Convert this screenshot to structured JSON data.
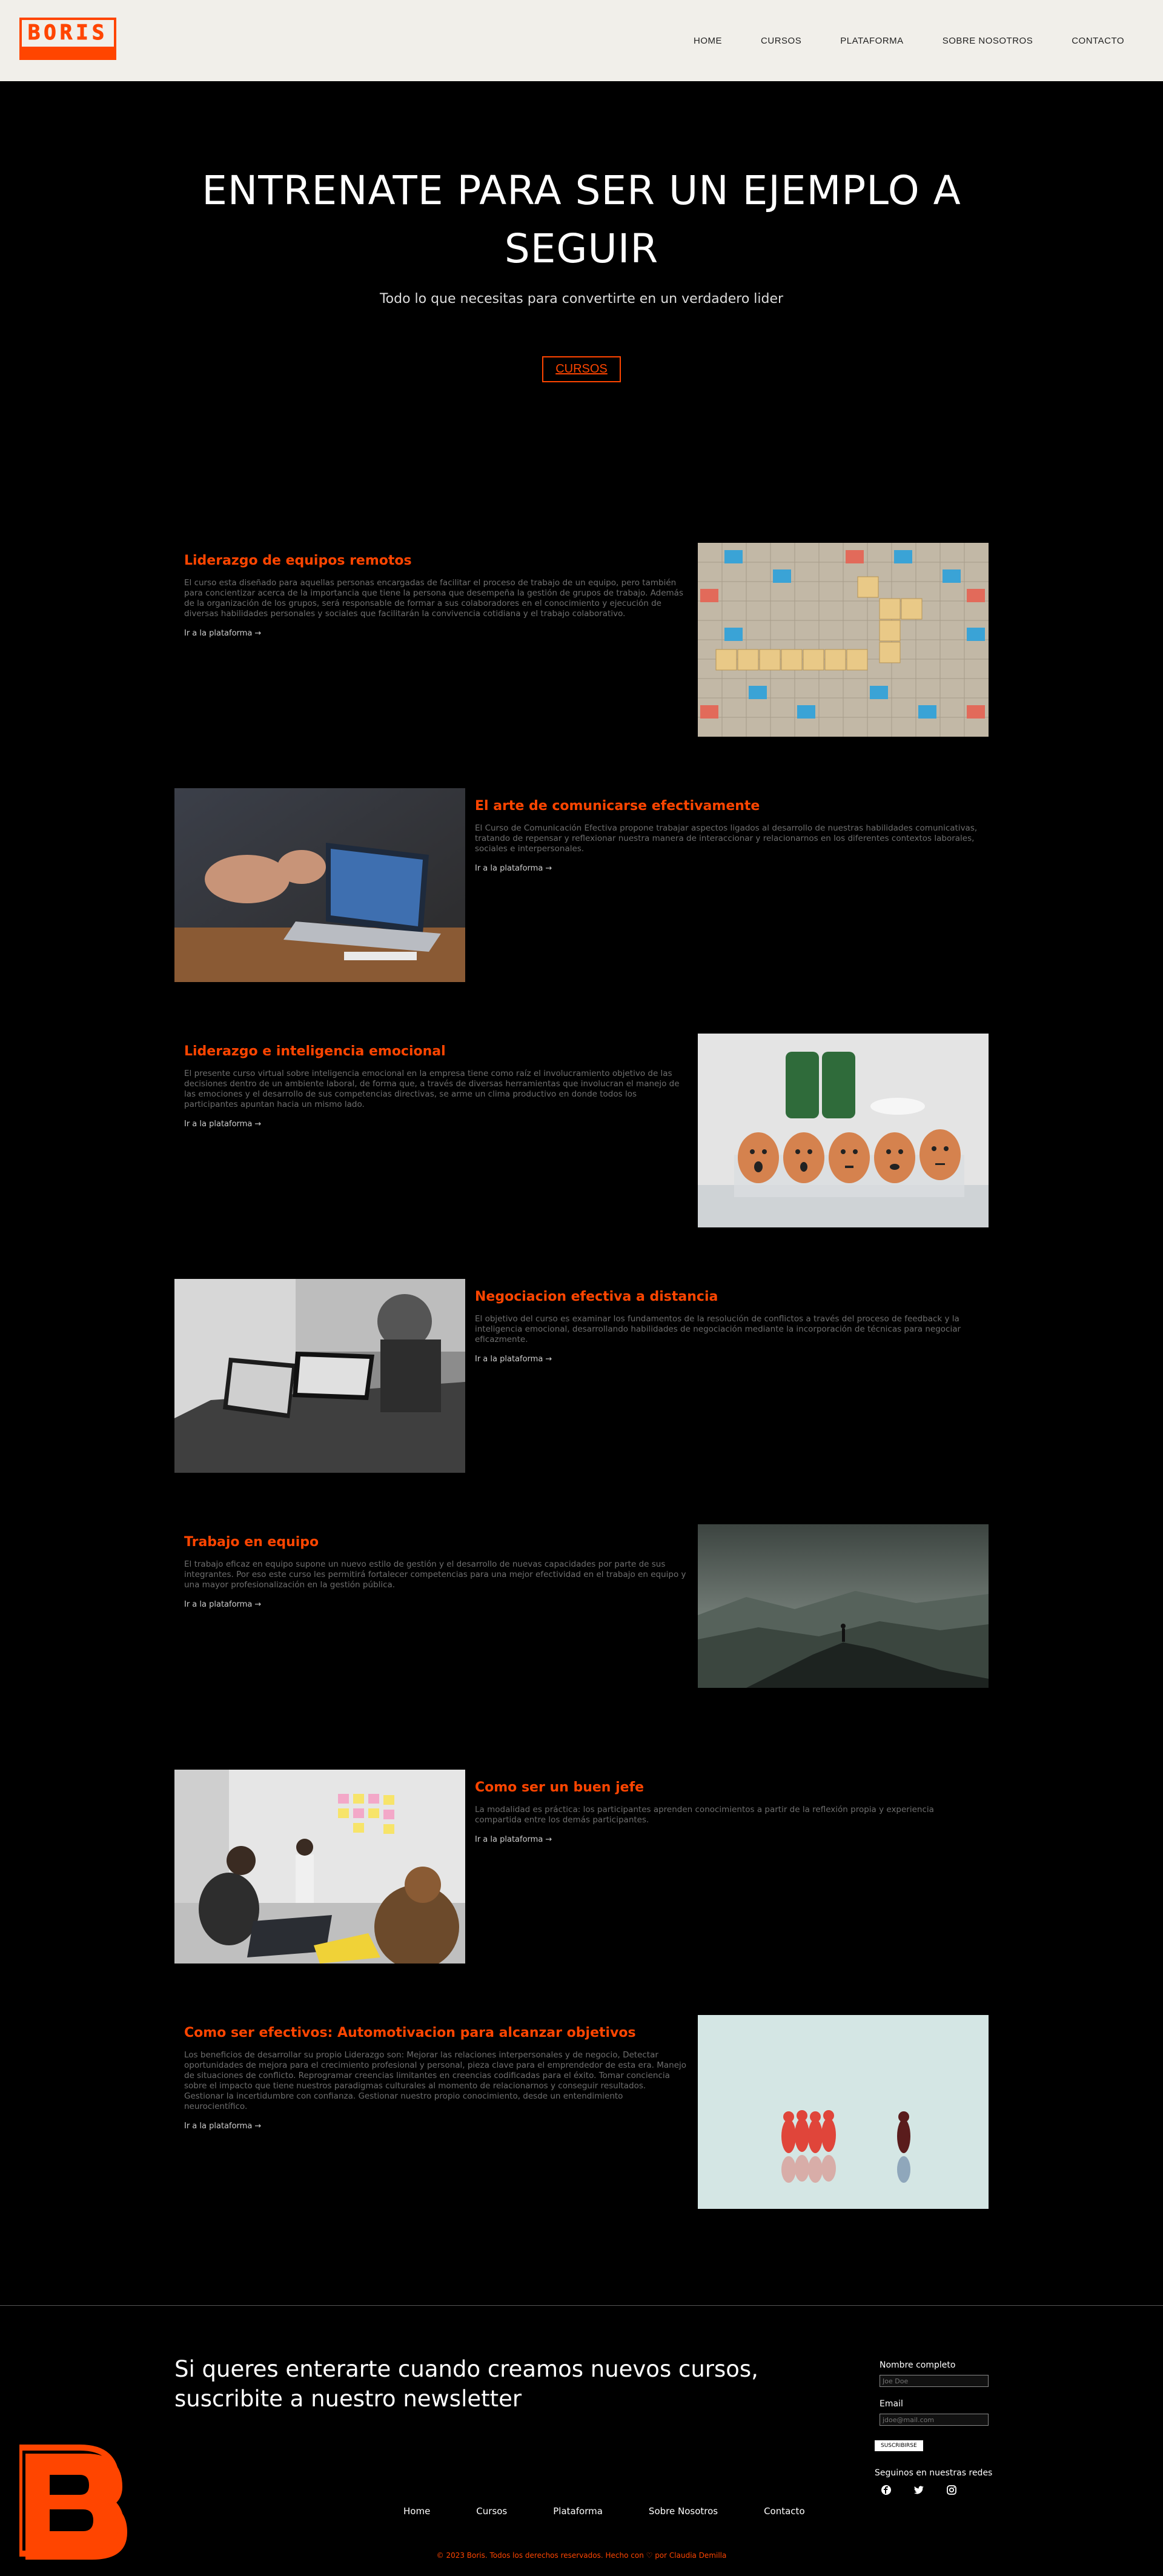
{
  "brand": {
    "logo_text": "BORIS",
    "accent": "#ff4500"
  },
  "nav": {
    "items": [
      {
        "label": "HOME"
      },
      {
        "label": "CURSOS"
      },
      {
        "label": "PLATAFORMA"
      },
      {
        "label": "SOBRE NOSOTROS"
      },
      {
        "label": "CONTACTO"
      }
    ]
  },
  "hero": {
    "title": "ENTRENATE PARA SER UN EJEMPLO A SEGUIR",
    "subtitle": "Todo lo que necesitas para convertirte en un verdadero lider",
    "button": "CURSOS"
  },
  "courses": [
    {
      "title": "Liderazgo de equipos remotos",
      "description": "El curso esta diseñado para aquellas personas encargadas de facilitar el proceso de trabajo de un equipo, pero también para concientizar acerca de la importancia que tiene la persona que desempeña la gestión de grupos de trabajo. Además de la organización de los grupos, será responsable de formar a sus colaboradores en el conocimiento y ejecución de diversas habilidades personales y sociales que facilitarán la convivencia cotidiana y el trabajo colaborativo.",
      "link": "Ir a la plataforma →",
      "image": "scrabble-team-succeed"
    },
    {
      "title": "El arte de comunicarse efectivamente",
      "description": "El Curso de Comunicación Efectiva propone trabajar aspectos ligados al desarrollo de nuestras habilidades comunicativas, tratando de repensar y reflexionar nuestra manera de interaccionar y relacionarnos en los diferentes contextos laborales, sociales e interpersonales.",
      "link": "Ir a la plataforma →",
      "image": "hands-laptop-meeting"
    },
    {
      "title": "Liderazgo e inteligencia emocional",
      "description": "El presente curso virtual sobre inteligencia emocional en la empresa tiene como raíz el involucramiento objetivo de las decisiones dentro de un ambiente laboral, de forma que, a través de diversas herramientas que involucran el manejo de las emociones y el desarrollo de sus competencias directivas, se arme un clima productivo en donde todos los participantes apuntan hacia un mismo lado.",
      "link": "Ir a la plataforma →",
      "image": "eggs-faces"
    },
    {
      "title": "Negociacion efectiva a distancia",
      "description": "El objetivo del curso es examinar los fundamentos de la resolución de conflictos a través del proceso de feedback y la inteligencia emocional, desarrollando habilidades de negociación mediante la incorporación de técnicas para negociar eficazmente.",
      "link": "Ir a la plataforma →",
      "image": "video-call-laptop"
    },
    {
      "title": "Trabajo en equipo",
      "description": "El trabajo eficaz en equipo supone un nuevo estilo de gestión y el desarrollo de nuevas capacidades por parte de sus integrantes. Por eso este curso les permitirá fortalecer competencias para una mejor efectividad en el trabajo en equipo y una mayor profesionalización en la gestión pública.",
      "link": "Ir a la plataforma →",
      "image": "mountain-summit"
    },
    {
      "title": "Como ser un buen jefe",
      "description": "La modalidad es práctica: los participantes aprenden conocimientos a partir de la reflexión propia y experiencia compartida entre los demás participantes.",
      "link": "Ir a la plataforma →",
      "image": "team-sticky-notes"
    },
    {
      "title": "Como ser efectivos: Automotivacion para alcanzar objetivos",
      "description": "Los beneficios de desarrollar su propio Liderazgo son: Mejorar las relaciones interpersonales y de negocio, Detectar oportunidades de mejora para el crecimiento profesional y personal, pieza clave para el emprendedor de esta era. Manejo de situaciones de conflicto. Reprogramar creencias limitantes en creencias codificadas para el éxito. Tomar conciencia sobre el impacto que tiene nuestros paradigmas culturales al momento de relacionarnos y conseguir resultados. Gestionar la incertidumbre con confianza. Gestionar nuestro propio conocimiento, desde un entendimiento neurocientífico.",
      "link": "Ir a la plataforma →",
      "image": "red-pawns-leader"
    }
  ],
  "newsletter": {
    "title": "Si queres enterarte cuando creamos nuevos cursos, suscribite a nuestro newsletter",
    "name_label": "Nombre completo",
    "name_placeholder": "Joe Doe",
    "email_label": "Email",
    "email_placeholder": "jdoe@mail.com",
    "submit": "SUSCRIBIRSE"
  },
  "social": {
    "title": "Seguinos en nuestras redes",
    "icons": [
      "facebook-icon",
      "twitter-icon",
      "instagram-icon"
    ]
  },
  "footer_nav": {
    "items": [
      {
        "label": "Home"
      },
      {
        "label": "Cursos"
      },
      {
        "label": "Plataforma"
      },
      {
        "label": "Sobre Nosotros"
      },
      {
        "label": "Contacto"
      }
    ]
  },
  "copyright": "© 2023 Boris. Todos los derechos reservados. Hecho con ♡ por Claudia Demilla"
}
